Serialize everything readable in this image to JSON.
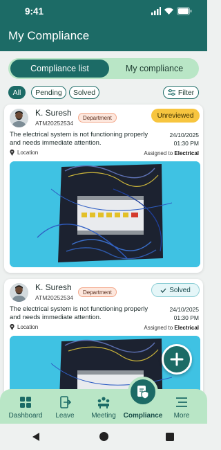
{
  "status_bar": {
    "time": "9:41"
  },
  "header": {
    "title": "My Compliance"
  },
  "segment": {
    "active": "Compliance list",
    "inactive": "My compliance"
  },
  "filters": {
    "chips": [
      "All",
      "Pending",
      "Solved"
    ],
    "filter_label": "Filter"
  },
  "cards": [
    {
      "name": "K. Suresh",
      "emp_id": "ATM20252534",
      "dept": "Department",
      "status": "Unreviewed",
      "description": "The electrical system is not functioning properly and needs immediate attention.",
      "date": "24/10/2025",
      "time": "01:30 PM",
      "location": "Location",
      "assigned_prefix": "Assigned to",
      "assigned_to": "Electrical"
    },
    {
      "name": "K. Suresh",
      "emp_id": "ATM20252534",
      "dept": "Department",
      "status": "Solved",
      "description": "The electrical system is not functioning properly and needs immediate attention.",
      "date": "24/10/2025",
      "time": "01:30 PM",
      "location": "Location",
      "assigned_prefix": "Assigned to",
      "assigned_to": "Electrical"
    }
  ],
  "tabbar": {
    "items": [
      "Dashboard",
      "Leave",
      "Meeting",
      "Compliance",
      "More"
    ],
    "active": "Compliance"
  },
  "colors": {
    "primary": "#1c6b66",
    "accent_light": "#b9e6c6",
    "unreviewed": "#f7c53f",
    "solved_bg": "#e5f6f8",
    "dept_bg": "#fde7dd"
  }
}
